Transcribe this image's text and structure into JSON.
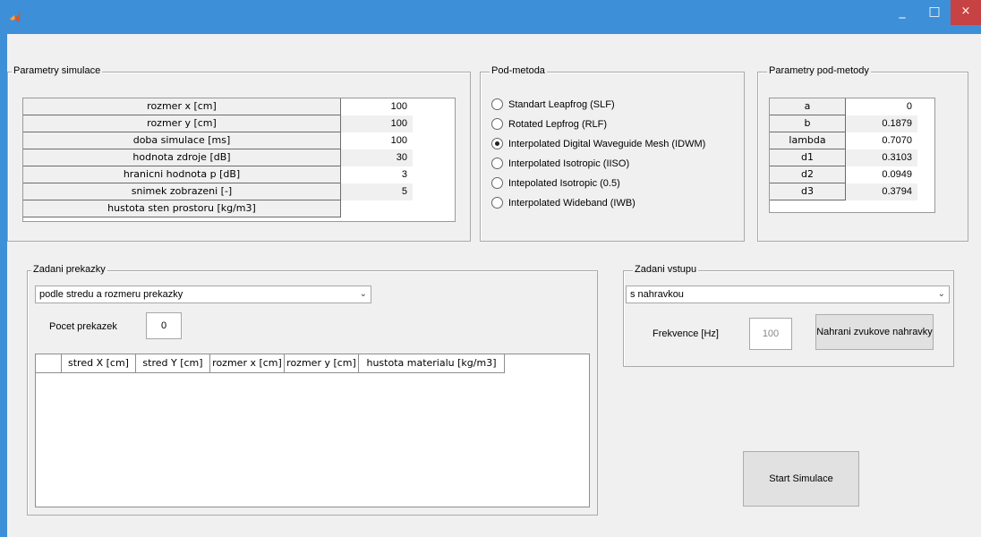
{
  "window": {
    "minimize": "_",
    "maximize": "□",
    "close": "×"
  },
  "sim_params": {
    "title": "Parametry simulace",
    "rows": [
      {
        "name": "rozmer x [cm]",
        "value": "100"
      },
      {
        "name": "rozmer y [cm]",
        "value": "100"
      },
      {
        "name": "doba simulace [ms]",
        "value": "100"
      },
      {
        "name": "hodnota zdroje [dB]",
        "value": "30"
      },
      {
        "name": "hranicni hodnota p [dB]",
        "value": "3"
      },
      {
        "name": "snimek zobrazeni [-]",
        "value": "5"
      },
      {
        "name": "hustota sten prostoru [kg/m3]",
        "value": ""
      }
    ]
  },
  "submethod": {
    "title": "Pod-metoda",
    "options": [
      {
        "label": "Standart Leapfrog (SLF)",
        "selected": false
      },
      {
        "label": "Rotated Lepfrog (RLF)",
        "selected": false
      },
      {
        "label": "Interpolated Digital Waveguide Mesh (IDWM)",
        "selected": true
      },
      {
        "label": "Interpolated Isotropic (IISO)",
        "selected": false
      },
      {
        "label": "Intepolated Isotropic (0.5)",
        "selected": false
      },
      {
        "label": "Interpolated Wideband (IWB)",
        "selected": false
      }
    ]
  },
  "submethod_params": {
    "title": "Parametry pod-metody",
    "rows": [
      {
        "name": "a",
        "value": "0"
      },
      {
        "name": "b",
        "value": "0.1879"
      },
      {
        "name": "lambda",
        "value": "0.7070"
      },
      {
        "name": "d1",
        "value": "0.3103"
      },
      {
        "name": "d2",
        "value": "0.0949"
      },
      {
        "name": "d3",
        "value": "0.3794"
      }
    ]
  },
  "obstacles": {
    "title": "Zadani prekazky",
    "mode_selected": "podle stredu a rozmeru prekazky",
    "count_label": "Pocet prekazek",
    "count_value": "0",
    "columns": [
      "stred X [cm]",
      "stred Y [cm]",
      "rozmer x [cm]",
      "rozmer y [cm]",
      "hustota materialu [kg/m3]"
    ]
  },
  "input": {
    "title": "Zadani vstupu",
    "mode_selected": "s nahravkou",
    "freq_label": "Frekvence [Hz]",
    "freq_value": "100",
    "record_button": "Nahrani zvukove nahravky"
  },
  "start_button": "Start Simulace",
  "colors": {
    "titlebar": "#3d8fd8",
    "close": "#c74242",
    "background": "#f0f0f0"
  },
  "icons": {
    "app": "matlab-logo-icon",
    "dropdown": "chevron-down-icon"
  }
}
